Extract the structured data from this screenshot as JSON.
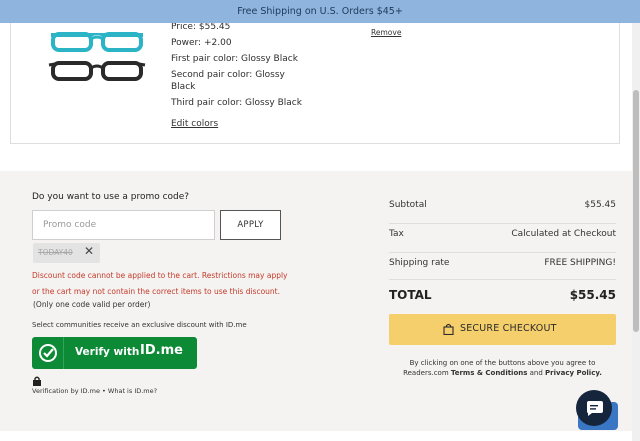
{
  "banner": {
    "text": "Free Shipping on U.S. Orders $45+"
  },
  "product": {
    "price_label": "Price:",
    "price": "$55.45",
    "power_label": "Power:",
    "power": "+2.00",
    "first_label": "First pair color:",
    "first": "Glossy Black",
    "second_label": "Second pair color:",
    "second": "Glossy Black",
    "third_label": "Third pair color:",
    "third": "Glossy Black",
    "edit": "Edit colors",
    "remove": "Remove"
  },
  "promo": {
    "title": "Do you want to use a promo code?",
    "placeholder": "Promo code",
    "apply": "APPLY",
    "code": "TODAY40",
    "error_line1": "Discount code cannot be applied to the cart. Restrictions may apply",
    "error_line2": "or the cart may not contain the correct items to use this discount.",
    "note": "(Only one code valid per order)"
  },
  "idme": {
    "text": "Select communities receive an exclusive discount with ID.me",
    "button": "Verify with",
    "logo": "ID.me",
    "footer": "Verification by ID.me • What is ID.me?"
  },
  "summary": {
    "subtotal_label": "Subtotal",
    "subtotal": "$55.45",
    "tax_label": "Tax",
    "tax": "Calculated at Checkout",
    "shipping_label": "Shipping rate",
    "shipping": "FREE SHIPPING!",
    "total_label": "TOTAL",
    "total": "$55.45",
    "checkout": "SECURE CHECKOUT",
    "agree1": "By clicking on one of the buttons above you agree to",
    "agree2_pre": "Readers.com ",
    "terms": "Terms & Conditions",
    "and": " and ",
    "privacy": "Privacy Policy."
  },
  "icons": {
    "remove_chip": "close-icon",
    "checkout": "shopping-bag-icon",
    "chat": "chat-bubble-icon",
    "lock": "lock-icon",
    "verify": "check-circle-icon"
  }
}
